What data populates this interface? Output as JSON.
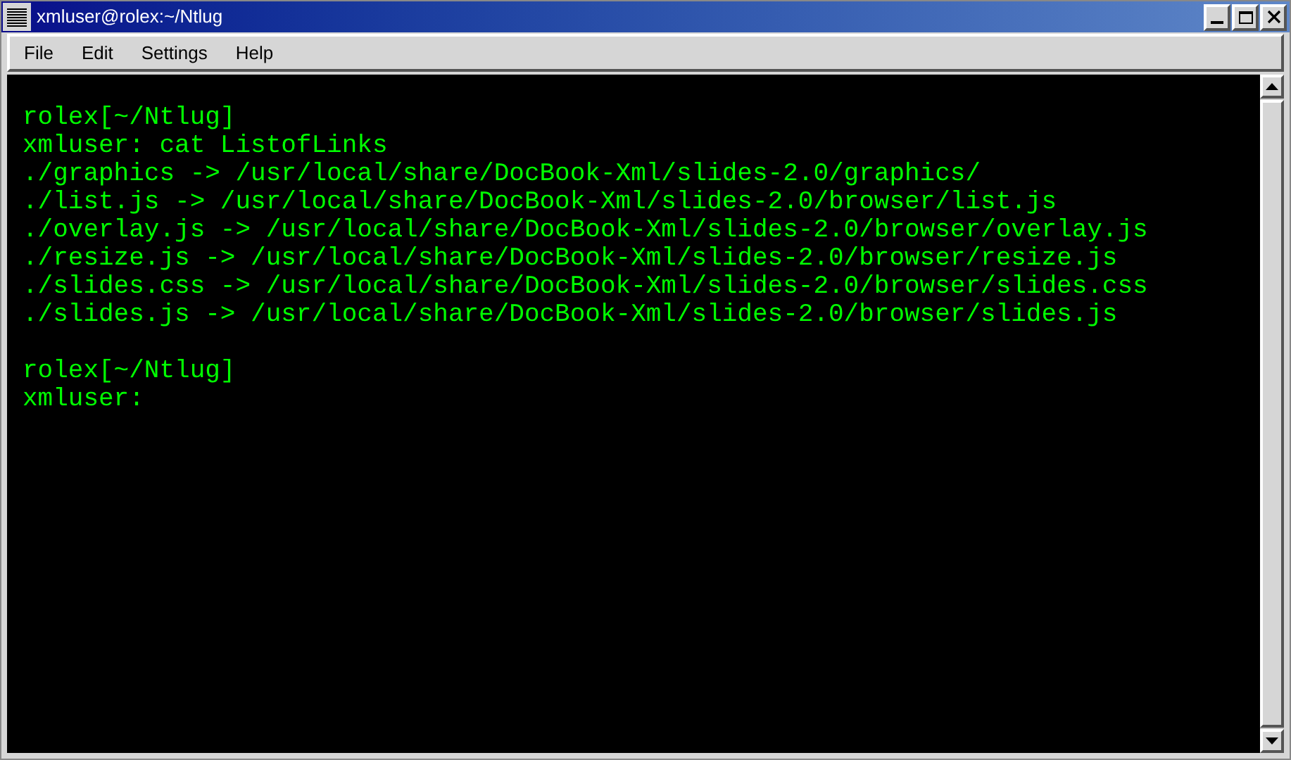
{
  "window": {
    "title": "xmluser@rolex:~/Ntlug"
  },
  "menu": [
    "File",
    "Edit",
    "Settings",
    "Help"
  ],
  "terminal": {
    "blocks": [
      [
        "rolex[~/Ntlug]",
        "xmluser: cat ListofLinks",
        "./graphics -> /usr/local/share/DocBook-Xml/slides-2.0/graphics/",
        "./list.js -> /usr/local/share/DocBook-Xml/slides-2.0/browser/list.js",
        "./overlay.js -> /usr/local/share/DocBook-Xml/slides-2.0/browser/overlay.js",
        "./resize.js -> /usr/local/share/DocBook-Xml/slides-2.0/browser/resize.js",
        "./slides.css -> /usr/local/share/DocBook-Xml/slides-2.0/browser/slides.css",
        "./slides.js -> /usr/local/share/DocBook-Xml/slides-2.0/browser/slides.js"
      ],
      [
        "rolex[~/Ntlug]",
        "xmluser:"
      ]
    ]
  }
}
